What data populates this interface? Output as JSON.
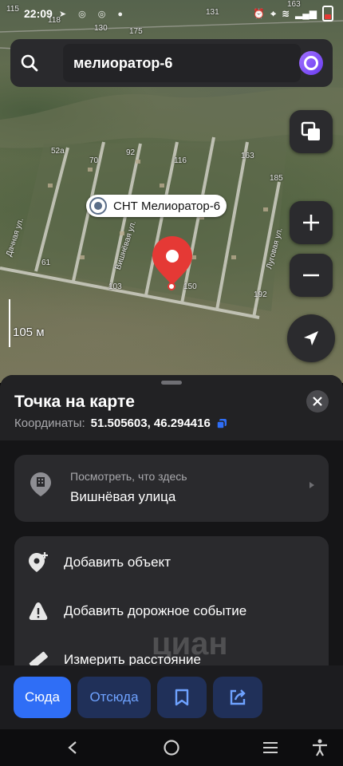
{
  "status_bar": {
    "time": "22:09",
    "left_icons": [
      "telegram-icon",
      "chrome-icon",
      "chrome-icon",
      "facebook-icon",
      "dot"
    ],
    "right_icons": [
      "alarm-icon",
      "location-icon",
      "wifi-icon",
      "signal-icon",
      "battery-icon"
    ]
  },
  "search": {
    "query": "мелиоратор-6",
    "icon": "search-icon",
    "assistant_icon": "alice-icon"
  },
  "map": {
    "plot_numbers": [
      "115",
      "118",
      "130",
      "175",
      "131",
      "163",
      "52а",
      "70",
      "92",
      "116",
      "163",
      "185",
      "61",
      "103",
      "150",
      "192"
    ],
    "street_names": [
      "Дачная ул.",
      "Вишнёвая ул.",
      "Луговая ул."
    ],
    "place_label": "СНТ Мелиоратор-6",
    "scale": "105 м",
    "accent_color": "#e53935"
  },
  "sheet": {
    "title": "Точка на карте",
    "coords_label": "Координаты:",
    "coords_value": "51.505603, 46.294416",
    "where": {
      "caption": "Посмотреть, что здесь",
      "value": "Вишнёвая улица"
    },
    "actions": [
      {
        "label": "Добавить объект",
        "icon": "add-place-icon"
      },
      {
        "label": "Добавить дорожное событие",
        "icon": "road-event-icon"
      },
      {
        "label": "Измерить расстояние",
        "icon": "ruler-icon"
      }
    ],
    "buttons": {
      "to_here": "Сюда",
      "from_here": "Отсюда"
    },
    "watermark": "циан",
    "watermark_id": "ID 295164507",
    "primary_color": "#2f6ef6"
  }
}
